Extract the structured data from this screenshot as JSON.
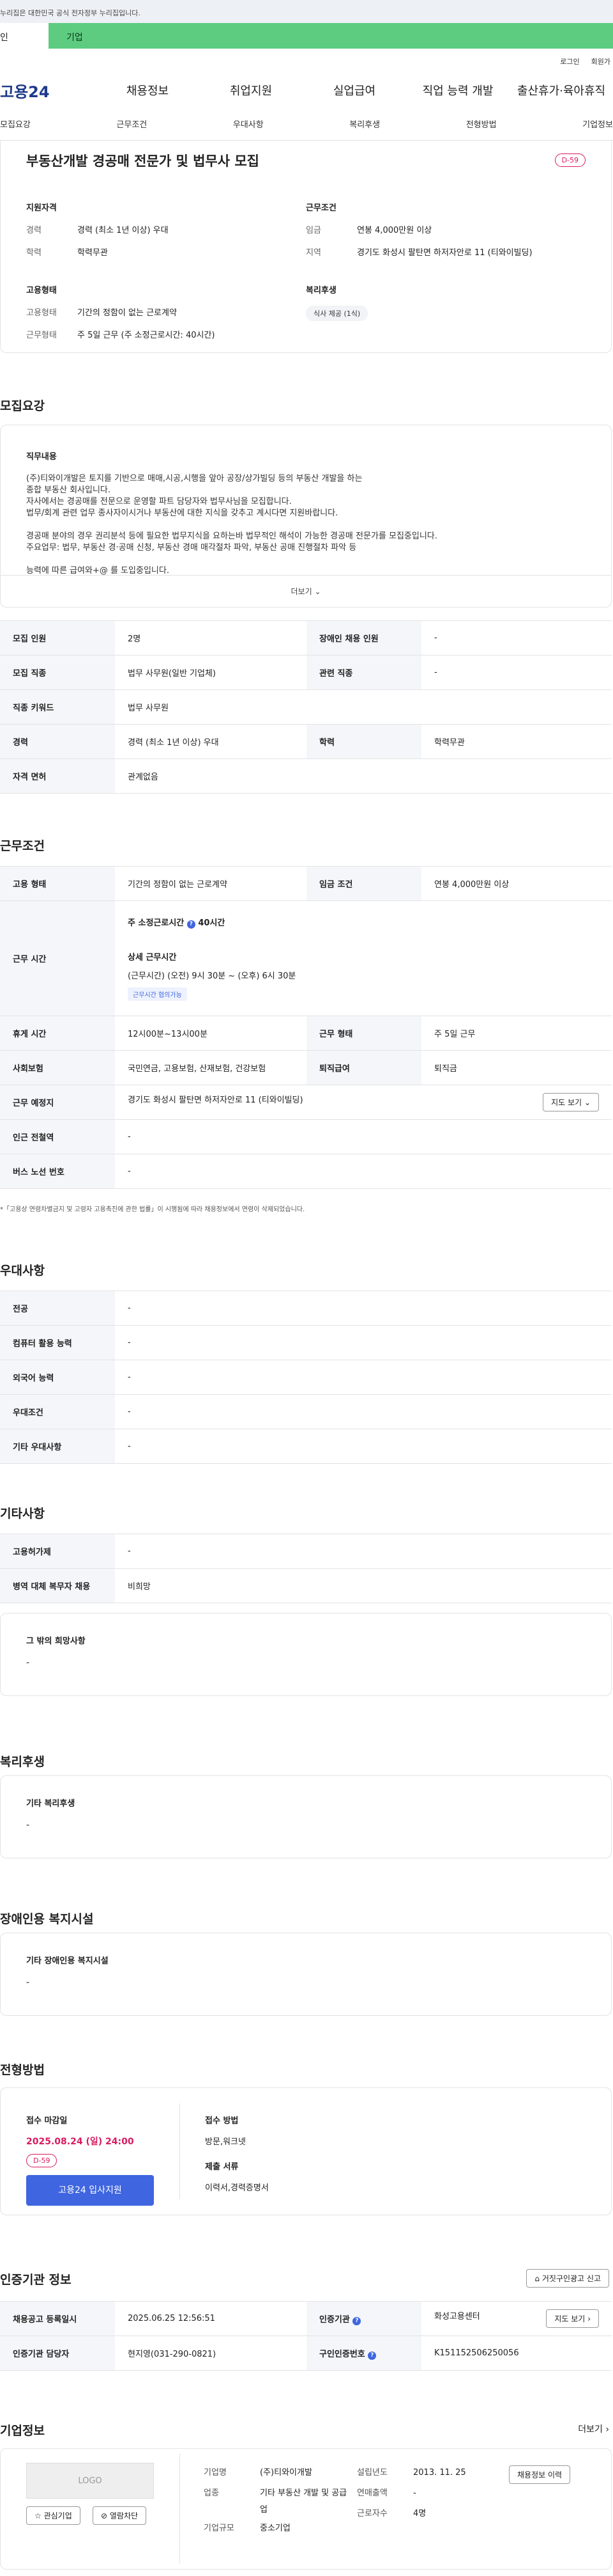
{
  "banner": "누리집은 대한민국 공식 전자정부 누리집입니다.",
  "user_tabs": [
    "인",
    "기업"
  ],
  "util": [
    "로그인",
    "회원가"
  ],
  "logo": "고용24",
  "gnb": [
    "채용정보",
    "취업지원",
    "실업급여",
    "직업 능력 개발",
    "출산휴가·육아휴직"
  ],
  "snb": [
    "모집요강",
    "근무조건",
    "우대사항",
    "복리후생",
    "전형방법",
    "기업정보"
  ],
  "header": {
    "title": "부동산개발 경공매 전문가 및 법무사 모집",
    "dday": "D-59",
    "qual_title": "지원자격",
    "qual": [
      [
        "경력",
        "경력 (최소 1년 이상) 우대"
      ],
      [
        "학력",
        "학력무관"
      ]
    ],
    "cond_title": "근무조건",
    "cond": [
      [
        "임금",
        "연봉 4,000만원 이상"
      ],
      [
        "지역",
        "경기도 화성시 팔탄면 하저자안로 11 (티와이빌딩)"
      ]
    ],
    "emp_title": "고용형태",
    "emp": [
      [
        "고용형태",
        "기간의 정함이 없는 근로계약"
      ],
      [
        "근무형태",
        "주 5일 근무 (주 소정근로시간: 40시간)"
      ]
    ],
    "welfare_title": "복리후생",
    "welfare_chip": "식사 제공 (1식)"
  },
  "recruit": {
    "title": "모집요강",
    "duty_title": "직무내용",
    "lines": [
      "(주)티와이개발은 토지를 기반으로 매매,시공,시행을 앞아 공장/상가빌딩 등의 부동산 개발을 하는",
      "종합 부동산 회사입니다.",
      "자사에서는 경공매를 전문으로 운영할 파트 담당자와 법무사님을 모집합니다.",
      "법무/회계 관련 업무 종사자이시거나 부동산에 대한 지식을 갖추고 계시다면 지원바랍니다.",
      "",
      "경공매 분야의 경우 권리분석 등에 필요한 법무지식을 요하는바 법무적인 해석이 가능한 경공매 전문가를 모집중입니다.",
      "주요업무: 법무, 부동산 경·공매 신청, 부동산 경매 매각절차 파악, 부동산 공매 진행절차 파악 등",
      "",
      "능력에 따른 급여와+@ 를 도입중입니다."
    ],
    "more": "더보기",
    "rows": [
      [
        "모집 인원",
        "2명",
        "장애인 채용 인원",
        "-"
      ],
      [
        "모집 직종",
        "법무 사무원(일반 기업체)",
        "관련 직종",
        "-"
      ],
      [
        "직종 키워드",
        "법무 사무원",
        "",
        ""
      ],
      [
        "경력",
        "경력 (최소 1년 이상) 우대",
        "학력",
        "학력무관"
      ],
      [
        "자격 면허",
        "관계없음",
        "",
        ""
      ]
    ]
  },
  "work": {
    "title": "근무조건",
    "r1": [
      "고용 형태",
      "기간의 정함이 없는 근로계약",
      "임금 조건",
      "연봉 4,000만원 이상"
    ],
    "hours_label": "근무 시간",
    "hours_main": "주 소정근로시간",
    "hours_val": "40시간",
    "detail_title": "상세 근무시간",
    "detail": "(근무시간) (오전) 9시 30분 ~ (오후) 6시 30분",
    "tag": "근무시간 협의가능",
    "rows": [
      [
        "휴게 시간",
        "12시00분~13시00분",
        "근무 형태",
        "주 5일 근무"
      ],
      [
        "사회보험",
        "국민연금, 고용보험, 산재보험, 건강보험",
        "퇴직급여",
        "퇴직금"
      ]
    ],
    "loc": [
      "근무 예정지",
      "경기도 화성시 팔탄면 하저자안로 11 (티와이빌딩)"
    ],
    "map": "지도 보기",
    "rows2": [
      [
        "인근 전철역",
        "-"
      ],
      [
        "버스 노선 번호",
        "-"
      ]
    ],
    "note": "*「고용상 연령차별금지 및 고령자 고용촉진에 관한 법률」이 시행됨에 따라 채용정보에서 연령이 삭제되었습니다."
  },
  "pref": {
    "title": "우대사항",
    "rows": [
      [
        "전공",
        "-"
      ],
      [
        "컴퓨터 활용 능력",
        "-"
      ],
      [
        "외국어 능력",
        "-"
      ],
      [
        "우대조건",
        "-"
      ],
      [
        "기타 우대사항",
        "-"
      ]
    ]
  },
  "etc": {
    "title": "기타사항",
    "rows": [
      [
        "고용허가제",
        "-"
      ],
      [
        "병역 대체 복무자 채용",
        "비희망"
      ]
    ],
    "other_title": "그 밖의 희망사항",
    "other_val": "-"
  },
  "welfare": {
    "title": "복리후생",
    "box_title": "기타 복리후생",
    "box_val": "-"
  },
  "disab": {
    "title": "장애인용 복지시설",
    "box_title": "기타 장애인용 복지시설",
    "box_val": "-"
  },
  "process": {
    "title": "전형방법",
    "deadline_title": "접수 마감일",
    "deadline": "2025.08.24 (일) 24:00",
    "dday": "D-59",
    "apply": "고용24 입사지원",
    "method_title": "접수 방법",
    "method": "방문,워크넷",
    "docs_title": "제출 서류",
    "docs": "이력서,경력증명서"
  },
  "cert": {
    "title": "인증기관 정보",
    "report": "거짓구인광고 신고",
    "rows": [
      [
        "채용공고 등록일시",
        "2025.06.25 12:56:51",
        "인증기관",
        "화성고용센터"
      ],
      [
        "인증기관 담당자",
        "현지영(031-290-0821)",
        "구인인증번호",
        "K151152506250056"
      ]
    ],
    "map": "지도 보기"
  },
  "company": {
    "title": "기업정보",
    "more": "더보기",
    "logo": "LOGO",
    "fav": "관심기업",
    "block": "열람차단",
    "name_k": "기업명",
    "name": "(주)티와이개발",
    "est_k": "설립년도",
    "est": "2013. 11. 25",
    "ind_k": "업종",
    "ind": "기타 부동산 개발 및 공급업",
    "rev_k": "연매출액",
    "rev": "-",
    "emp_k": "근로자수",
    "emp": "4명",
    "size_k": "기업규모",
    "size": "중소기업",
    "hist": "채용정보 이력"
  }
}
